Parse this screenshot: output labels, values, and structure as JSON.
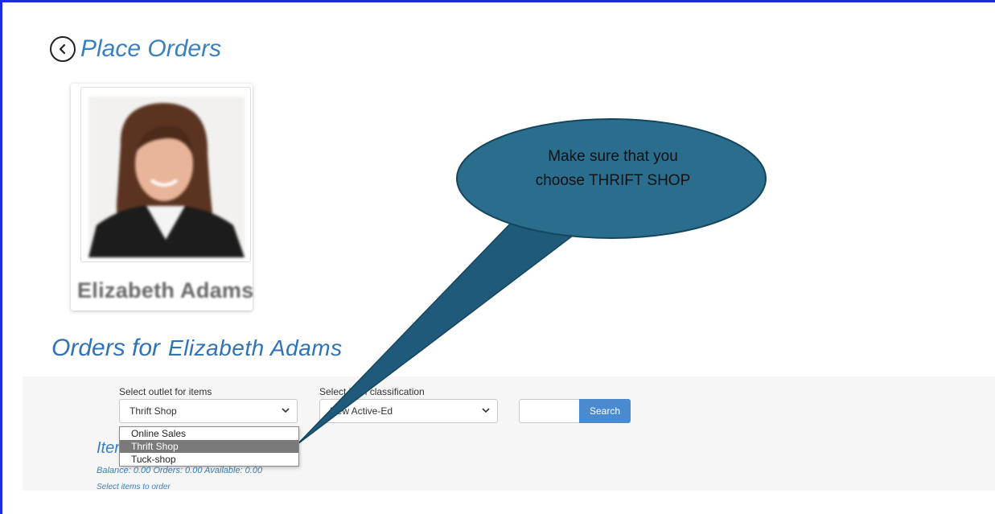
{
  "header": {
    "title": "Place Orders"
  },
  "profile": {
    "name": "Elizabeth Adams"
  },
  "orders": {
    "label": "Orders for",
    "name": "Elizabeth Adams"
  },
  "filters": {
    "outlet_label": "Select outlet for items",
    "outlet_selected": "Thrift Shop",
    "outlet_options": [
      "Online Sales",
      "Thrift Shop",
      "Tuck-shop"
    ],
    "classification_label": "Select item classification",
    "classification_selected": "New Active-Ed",
    "search_label": "Search"
  },
  "items": {
    "heading": "Items",
    "balance": "Balance: 0.00 Orders: 0.00 Available: 0.00",
    "hint": "Select items to order"
  },
  "callout": {
    "line1": "Make sure that you",
    "line2": "choose THRIFT SHOP"
  },
  "colors": {
    "frame_border": "#1c2fd6",
    "title_blue": "#3a7fc0",
    "button_blue": "#4a8bd0",
    "callout_fill": "#1f5a7a",
    "callout_ellipse": "#2a6d8c"
  }
}
